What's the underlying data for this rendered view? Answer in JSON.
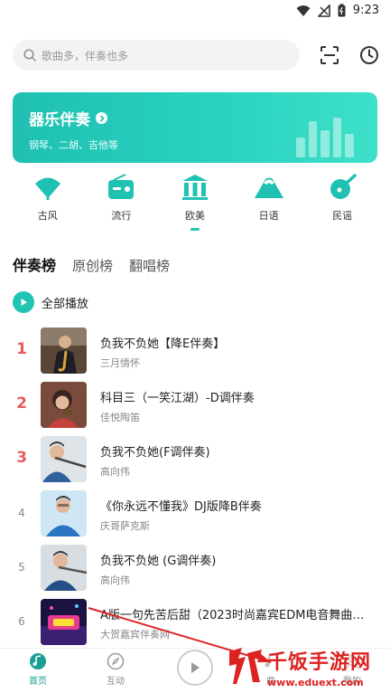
{
  "status_bar": {
    "time": "9:23"
  },
  "search": {
    "placeholder": "歌曲多，伴奏也多"
  },
  "banner": {
    "title": "器乐伴奏",
    "subtitle": "钢琴、二胡、吉他等"
  },
  "categories": [
    {
      "label": "古风",
      "icon": "fan-icon"
    },
    {
      "label": "流行",
      "icon": "radio-icon"
    },
    {
      "label": "欧美",
      "icon": "columns-icon"
    },
    {
      "label": "日语",
      "icon": "mountain-icon"
    },
    {
      "label": "民谣",
      "icon": "guitar-icon"
    }
  ],
  "selected_category": "欧美",
  "tabs": [
    {
      "label": "伴奏榜",
      "active": true
    },
    {
      "label": "原创榜",
      "active": false
    },
    {
      "label": "翻唱榜",
      "active": false
    }
  ],
  "play_all": {
    "label": "全部播放"
  },
  "songs": [
    {
      "rank": "1",
      "title": "负我不负她【降E伴奏】",
      "artist": "三月情怀"
    },
    {
      "rank": "2",
      "title": "科目三（一笑江湖）-D调伴奏",
      "artist": "佳悦陶笛"
    },
    {
      "rank": "3",
      "title": "负我不负她(F调伴奏)",
      "artist": "高向伟"
    },
    {
      "rank": "4",
      "title": "《你永远不懂我》DJ版降B伴奏",
      "artist": "庆哥萨克斯"
    },
    {
      "rank": "5",
      "title": "负我不负她 (G调伴奏)",
      "artist": "高向伟"
    },
    {
      "rank": "6",
      "title": "A版一句先苦后甜（2023时尚嘉宾EDM电音舞曲…",
      "artist": "大贺嘉宾伴奏网"
    }
  ],
  "bottom_nav": [
    {
      "label": "首页",
      "active": true
    },
    {
      "label": "互动",
      "active": false
    },
    {
      "label": "曲",
      "active": false
    },
    {
      "label": "我的",
      "active": false
    }
  ],
  "watermark": {
    "text": "千饭手游网",
    "url": "www.eduext.com"
  },
  "colors": {
    "accent": "#20c4b3",
    "rank_top": "#e65b5b",
    "watermark": "#dd2222"
  }
}
